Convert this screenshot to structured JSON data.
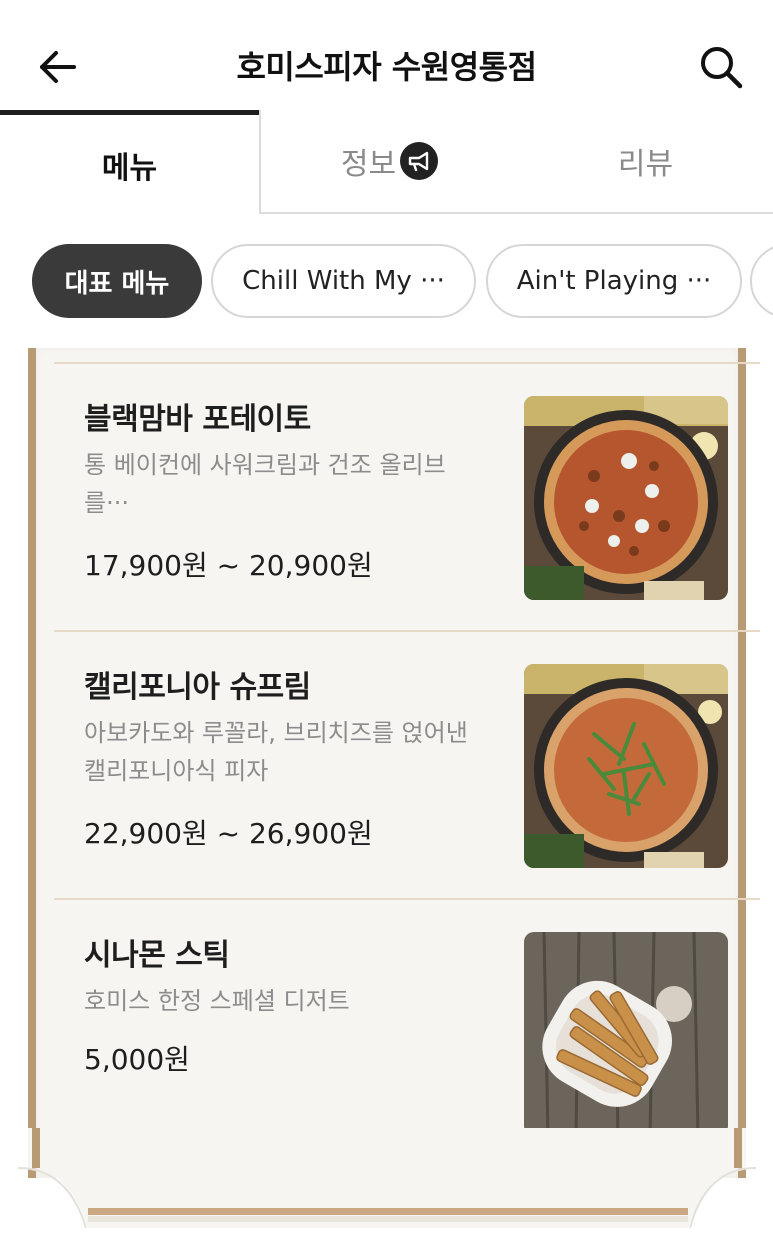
{
  "header": {
    "title": "호미스피자 수원영통점",
    "back_icon": "arrow-left-icon",
    "search_icon": "search-icon"
  },
  "tabs": [
    {
      "label": "메뉴",
      "active": true
    },
    {
      "label": "정보",
      "badge_icon": "megaphone-icon"
    },
    {
      "label": "리뷰"
    }
  ],
  "categories": [
    {
      "label": "대표 메뉴",
      "active": true
    },
    {
      "label": "Chill With My ···"
    },
    {
      "label": "Ain't Playing ···"
    },
    {
      "label": ""
    }
  ],
  "menu_items": [
    {
      "name": "블랙맘바 포테이토",
      "desc_line1": "통 베이컨에 사워크림과 건조 올리브",
      "desc_line2": "를···",
      "price": "17,900원 ~ 20,900원"
    },
    {
      "name": "캘리포니아 슈프림",
      "desc_line1": "아보카도와 루꼴라, 브리치즈를 얹어낸",
      "desc_line2": "캘리포니아식 피자",
      "price": "22,900원 ~ 26,900원"
    },
    {
      "name": "시나몬 스틱",
      "desc_line1": "호미스 한정 스페셜 디저트",
      "desc_line2": "",
      "price": "5,000원"
    }
  ],
  "colors": {
    "active_chip_bg": "#3a3a3a",
    "board_frame": "#b89a74",
    "board_paper": "#f7f5f1",
    "divider": "#e7d9c8"
  }
}
